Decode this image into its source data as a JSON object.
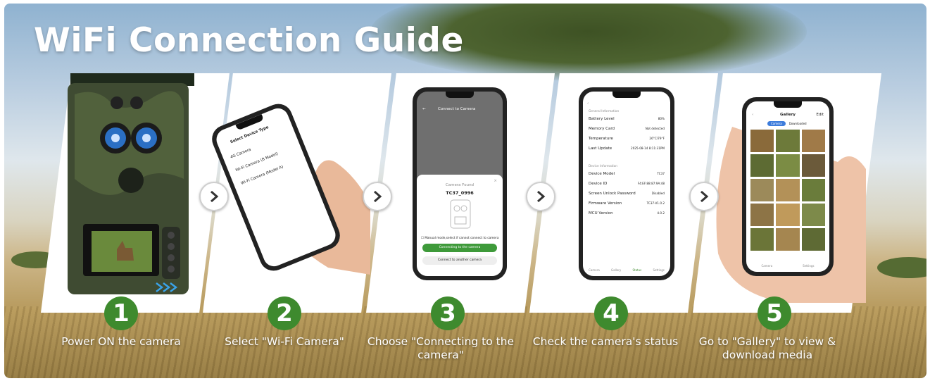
{
  "title": "WiFi Connection Guide",
  "steps": [
    {
      "number": "1",
      "caption": "Power ON the camera"
    },
    {
      "number": "2",
      "caption": "Select \"Wi-Fi Camera\""
    },
    {
      "number": "3",
      "caption": "Choose \"Connecting to the camera\""
    },
    {
      "number": "4",
      "caption": "Check the camera's status"
    },
    {
      "number": "5",
      "caption": "Go to \"Gallery\" to view & download media"
    }
  ],
  "phone2": {
    "header": "Select Device Type",
    "items": [
      "4G Camera",
      "Wi-Fi Camera (B Model)",
      "Wi-Fi Camera (Model A)"
    ]
  },
  "phone3": {
    "header": "Connect to Camera",
    "found_label": "Camera Found",
    "device_name": "TC37_0996",
    "manual_mode": "Manual mode,select if cannot connect to camera",
    "primary_button": "Connecting to the camera",
    "secondary_button": "Connect to another camera"
  },
  "phone4": {
    "section1": "General Information",
    "rows1": [
      {
        "label": "Battery Level",
        "value": "80%"
      },
      {
        "label": "Memory Card",
        "value": "Not detected"
      },
      {
        "label": "Temperature",
        "value": "26°C/79°F"
      },
      {
        "label": "Last Update",
        "value": "2025-08-14 8:11:31PM"
      }
    ],
    "section2": "Device Information",
    "rows2": [
      {
        "label": "Device Model",
        "value": "TC37"
      },
      {
        "label": "Device ID",
        "value": "F4:EF:88:87:9A:48"
      },
      {
        "label": "Screen Unlock Password",
        "value": "Disabled"
      },
      {
        "label": "Firmware Version",
        "value": "TC37-V1.0.2"
      },
      {
        "label": "MCU Version",
        "value": "4.0.2"
      }
    ],
    "tabs": [
      "Camera",
      "Gallery",
      "Status",
      "Settings"
    ]
  },
  "phone5": {
    "header": "Gallery",
    "edit": "Edit",
    "tabs": [
      "Camera",
      "Downloaded"
    ],
    "bottom_tabs": [
      "Camera",
      "Settings"
    ]
  },
  "colors": {
    "accent_green": "#3e8a2e",
    "caption_text": "#ffffff"
  }
}
